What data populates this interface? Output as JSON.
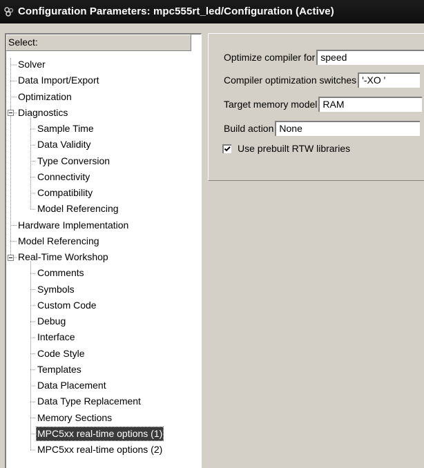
{
  "window": {
    "title": "Configuration Parameters: mpc555rt_led/Configuration (Active)"
  },
  "tree": {
    "header": "Select:",
    "items": [
      {
        "label": "Solver",
        "level": 1
      },
      {
        "label": "Data Import/Export",
        "level": 1
      },
      {
        "label": "Optimization",
        "level": 1
      },
      {
        "label": "Diagnostics",
        "level": 1,
        "expanded": true
      },
      {
        "label": "Sample Time",
        "level": 2
      },
      {
        "label": "Data Validity",
        "level": 2
      },
      {
        "label": "Type Conversion",
        "level": 2
      },
      {
        "label": "Connectivity",
        "level": 2
      },
      {
        "label": "Compatibility",
        "level": 2
      },
      {
        "label": "Model Referencing",
        "level": 2
      },
      {
        "label": "Hardware Implementation",
        "level": 1
      },
      {
        "label": "Model Referencing",
        "level": 1
      },
      {
        "label": "Real-Time Workshop",
        "level": 1,
        "expanded": true
      },
      {
        "label": "Comments",
        "level": 2
      },
      {
        "label": "Symbols",
        "level": 2
      },
      {
        "label": "Custom Code",
        "level": 2
      },
      {
        "label": "Debug",
        "level": 2
      },
      {
        "label": "Interface",
        "level": 2
      },
      {
        "label": "Code Style",
        "level": 2
      },
      {
        "label": "Templates",
        "level": 2
      },
      {
        "label": "Data Placement",
        "level": 2
      },
      {
        "label": "Data Type Replacement",
        "level": 2
      },
      {
        "label": "Memory Sections",
        "level": 2
      },
      {
        "label": "MPC5xx real-time options (1)",
        "level": 2,
        "selected": true
      },
      {
        "label": "MPC5xx real-time options (2)",
        "level": 2
      }
    ]
  },
  "params": {
    "optimize_compiler": {
      "label": "Optimize compiler for",
      "value": "speed"
    },
    "compiler_switches": {
      "label": "Compiler optimization switches",
      "value": "'-XO '"
    },
    "target_memory": {
      "label": "Target memory model",
      "value": "RAM"
    },
    "build_action": {
      "label": "Build action",
      "value": "None"
    },
    "prebuilt_rtw": {
      "label": "Use prebuilt RTW libraries",
      "checked": true
    }
  },
  "colors": {
    "selection": "#3a3a3a",
    "titlebar": "#141414",
    "dialog": "#d4d0c8"
  }
}
